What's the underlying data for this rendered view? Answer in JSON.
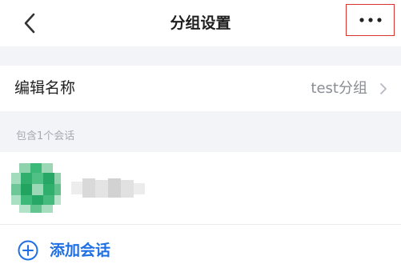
{
  "header": {
    "title": "分组设置",
    "back_icon": "chevron-left-icon",
    "more_icon": "more-horizontal-icon",
    "highlight_color": "#d9342b"
  },
  "group_name_row": {
    "label": "编辑名称",
    "value": "test分组",
    "chevron_icon": "chevron-right-icon"
  },
  "members_section": {
    "label": "包含1个会话",
    "members": [
      {
        "avatar": "blurred-green-avatar",
        "name_blurred": true
      }
    ]
  },
  "add_conversation": {
    "icon": "plus-circle-icon",
    "label": "添加会话",
    "color": "#1f6fe5"
  }
}
